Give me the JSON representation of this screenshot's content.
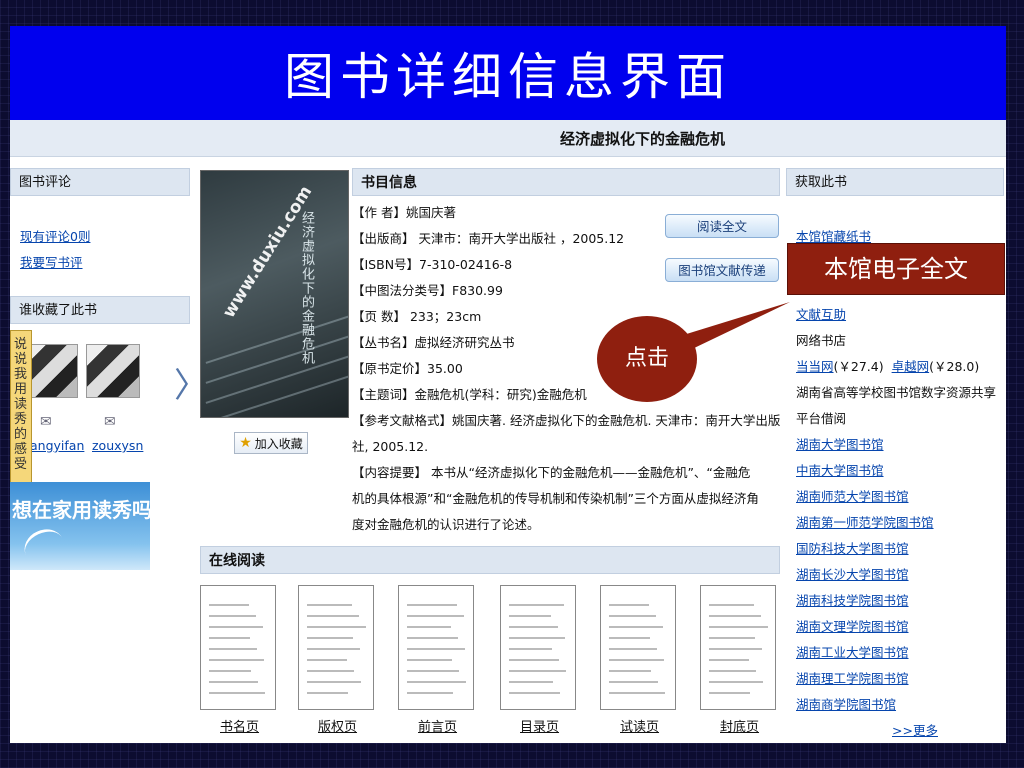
{
  "slide_title": "图书详细信息界面",
  "book_title": "经济虚拟化下的金融危机",
  "left": {
    "reviews_header": "图书评论",
    "review_count_link": "现有评论0则",
    "write_review_link": "我要写书评",
    "collectors_header": "谁收藏了此书",
    "users": [
      "angyifan",
      "zouxysn"
    ],
    "side_tab_text": "说说我用读秀的感受",
    "banner_text": "想在家用读秀吗"
  },
  "biblio": {
    "header": "书目信息",
    "lines": [
      "【作 者】姚国庆著",
      "【出版商】 天津市：南开大学出版社 ，2005.12",
      "【ISBN号】7-310-02416-8",
      "【中图法分类号】F830.99",
      "【页 数】 233；23cm",
      "【丛书名】虚拟经济研究丛书",
      "【原书定价】35.00",
      "【主题词】金融危机(学科：研究)金融危机",
      "【参考文献格式】姚国庆著. 经济虚拟化下的金融危机. 天津市：南开大学出版",
      "社, 2005.12.",
      "【内容提要】 本书从“经济虚拟化下的金融危机——金融危机”、“金融危",
      "机的具体根源”和“金融危机的传导机制和传染机制”三个方面从虚拟经济角",
      "度对金融危机的认识进行了论述。"
    ]
  },
  "cover": {
    "vertical_title": "经济虚拟化下的金融危机",
    "watermark": "www.duxiu.com"
  },
  "buttons": {
    "read_full": "阅读全文",
    "doc_delivery": "图书馆文献传递",
    "add_favorite": "加入收藏"
  },
  "annotations": {
    "callout": "本馆电子全文",
    "bubble": "点击"
  },
  "online": {
    "header": "在线阅读",
    "pages": [
      "书名页",
      "版权页",
      "前言页",
      "目录页",
      "试读页",
      "封底页"
    ]
  },
  "get_book": {
    "header": "获取此书",
    "paper_link": "本馆馆藏纸书",
    "mutual_aid_link": "文献互助",
    "online_stores_label": "网络书店",
    "stores": [
      {
        "name": "当当网",
        "price": "(￥27.4)"
      },
      {
        "name": "卓越网",
        "price": "(￥28.0)"
      }
    ],
    "hunan_share_label_1": "湖南省高等学校图书馆数字资源共享",
    "hunan_share_label_2": "平台借阅",
    "libraries": [
      "湖南大学图书馆",
      "中南大学图书馆",
      "湖南师范大学图书馆",
      "湖南第一师范学院图书馆",
      "国防科技大学图书馆",
      "湖南长沙大学图书馆",
      "湖南科技学院图书馆",
      "湖南文理学院图书馆",
      "湖南工业大学图书馆",
      "湖南理工学院图书馆",
      "湖南商学院图书馆"
    ],
    "more_link": ">>更多"
  },
  "colors": {
    "title_band": "#0000ee",
    "callout": "#8f1f0f",
    "link": "#0645ad"
  }
}
